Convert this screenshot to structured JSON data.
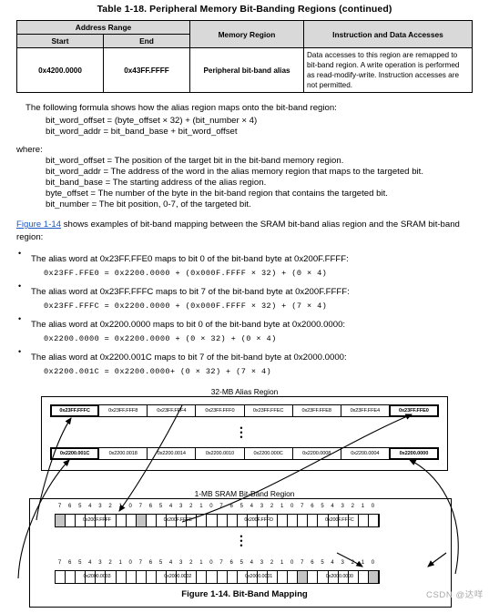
{
  "table": {
    "title": "Table 1-18. Peripheral Memory Bit-Banding Regions (continued)",
    "headers": {
      "address_range": "Address Range",
      "start": "Start",
      "end": "End",
      "memory_region": "Memory Region",
      "instruction_and_data_accesses": "Instruction and Data Accesses"
    },
    "rows": [
      {
        "start": "0x4200.0000",
        "end": "0x43FF.FFFF",
        "region": "Peripheral bit-band alias",
        "accesses": "Data accesses to this region are remapped to bit-band region. A write operation is performed as read-modify-write. Instruction accesses are not permitted."
      }
    ]
  },
  "body": {
    "intro": "The following formula shows how the alias region maps onto the bit-band region:",
    "formula1": "bit_word_offset = (byte_offset × 32) + (bit_number × 4)",
    "formula2": "bit_word_addr = bit_band_base + bit_word_offset",
    "where_label": "where:",
    "definitions": [
      "bit_word_offset = The position of the target bit in the bit-band memory region.",
      "bit_word_addr = The address of the word in the alias memory region that maps to the targeted bit.",
      "bit_band_base = The starting address of the alias region.",
      "byte_offset = The number of the byte in the bit-band region that contains the targeted bit.",
      "bit_number = The bit position, 0-7, of the targeted bit."
    ],
    "figure_ref_link": "Figure 1-14",
    "figure_ref_rest": " shows examples of bit-band mapping between the SRAM bit-band alias region and the SRAM bit-band region:",
    "bullets": [
      {
        "text": "The alias word at 0x23FF.FFE0 maps to bit 0 of the bit-band byte at 0x200F.FFFF:",
        "equation": "0x23FF.FFE0 = 0x2200.0000 + (0x000F.FFFF × 32) + (0 × 4)"
      },
      {
        "text": "The alias word at 0x23FF.FFFC maps to bit 7 of the bit-band byte at 0x200F.FFFF:",
        "equation": "0x23FF.FFFC = 0x2200.0000 + (0x000F.FFFF × 32) + (7 × 4)"
      },
      {
        "text": "The alias word at 0x2200.0000 maps to bit 0 of the bit-band byte at 0x2000.0000:",
        "equation": "0x2200.0000 = 0x2200.0000 + (0 × 32) + (0 × 4)"
      },
      {
        "text": "The alias word at 0x2200.001C maps to bit 7 of the bit-band byte at 0x2000.0000:",
        "equation": "0x2200.001C = 0x2200.0000+ (0 × 32) + (7 × 4)"
      }
    ]
  },
  "figure": {
    "caption": "Figure 1-14. Bit-Band Mapping",
    "alias_region_label": "32-MB Alias Region",
    "bitband_region_label": "1-MB SRAM Bit-Band Region",
    "alias_row_top": [
      "0x23FF.FFFC",
      "0x23FF.FFF8",
      "0x23FF.FFF4",
      "0x23FF.FFF0",
      "0x23FF.FFEC",
      "0x23FF.FFE8",
      "0x23FF.FFE4",
      "0x23FF.FFE0"
    ],
    "alias_row_bottom": [
      "0x2200.001C",
      "0x2200.0018",
      "0x2200.0014",
      "0x2200.0010",
      "0x2200.000C",
      "0x2200.0008",
      "0x2200.0004",
      "0x2200.0000"
    ],
    "alias_row_top_highlight": [
      0,
      7
    ],
    "alias_row_bottom_highlight": [
      0,
      7
    ],
    "bitband_row_top_bytes": [
      "0x200F.FFFF",
      "0x200F.FFFE",
      "0x200F.FFFD",
      "0x200F.FFFC"
    ],
    "bitband_row_bottom_bytes": [
      "0x2000.0003",
      "0x2000.0002",
      "0x2000.0001",
      "0x2000.0000"
    ],
    "bit_numbers": [
      "7",
      "6",
      "5",
      "4",
      "3",
      "2",
      "1",
      "0"
    ],
    "bitband_top_shaded": [
      "0:7",
      "1:7"
    ],
    "bitband_bottom_shaded": [
      "3:7",
      "3:0"
    ],
    "vertical_dots": "•"
  },
  "watermark": {
    "text": "CSDN @达咩"
  },
  "colors": {
    "link": "#1b57c4",
    "header_fill": "#d9d9d9",
    "cell_shade": "#c4c4c4",
    "watermark": "#a8a8a8"
  }
}
